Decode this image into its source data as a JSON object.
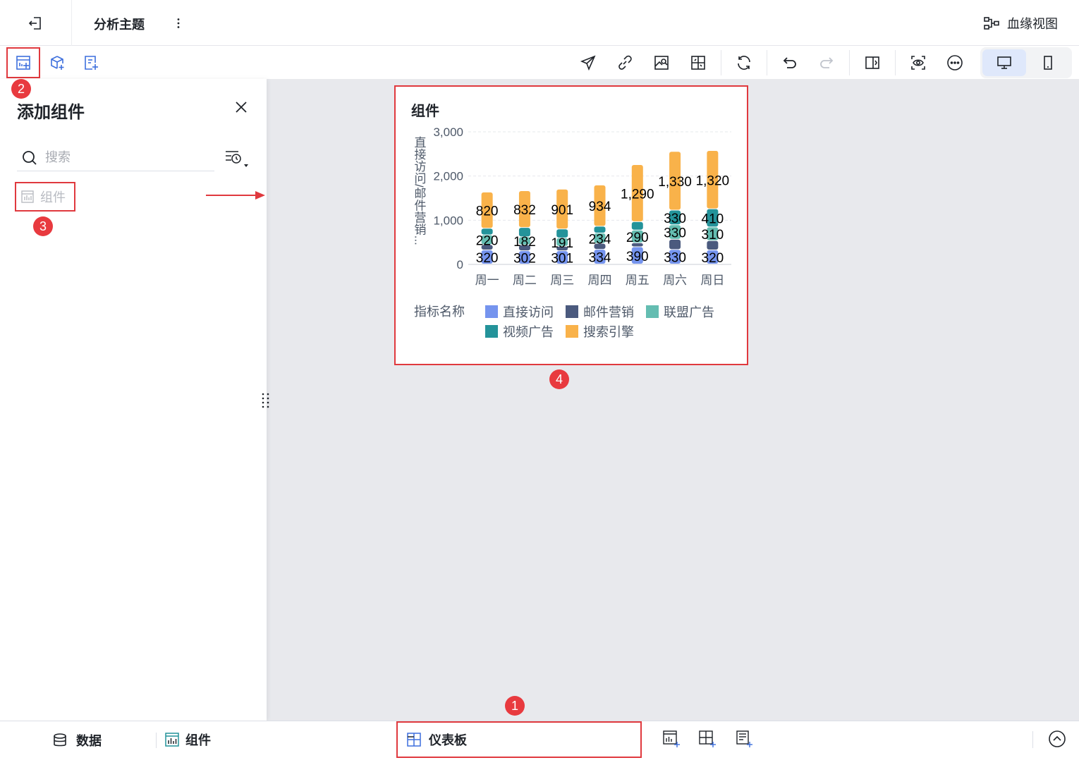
{
  "topbar": {
    "title": "分析主题",
    "lineage_label": "血缘视图"
  },
  "panel": {
    "title": "添加组件",
    "search_placeholder": "搜索",
    "component_item": "组件"
  },
  "badges": {
    "b1": "1",
    "b2": "2",
    "b3": "3",
    "b4": "4"
  },
  "card": {
    "title": "组件"
  },
  "bottombar": {
    "data_label": "数据",
    "component_label": "组件",
    "dashboard_label": "仪表板"
  },
  "colors": {
    "highlight_border": "#e0393e",
    "badge": "#e83a3f",
    "series": [
      "#7594ee",
      "#4b5a7e",
      "#64bdb1",
      "#24939a",
      "#f9b24a"
    ]
  },
  "chart_data": {
    "type": "bar",
    "stacked": true,
    "title": "",
    "ylabel": "直接访问/邮件营销...",
    "yticks": [
      "0",
      "1,000",
      "2,000",
      "3,000"
    ],
    "ylim": [
      0,
      3000
    ],
    "categories": [
      "周一",
      "周二",
      "周三",
      "周四",
      "周五",
      "周六",
      "周日"
    ],
    "legend_title": "指标名称",
    "series": [
      {
        "name": "直接访问",
        "values": [
          320,
          302,
          301,
          334,
          390,
          330,
          320
        ],
        "labels": [
          "320",
          "302",
          "301",
          "334",
          "390",
          "330",
          "320"
        ]
      },
      {
        "name": "邮件营销",
        "values": [
          120,
          132,
          101,
          134,
          90,
          230,
          210
        ],
        "labels": [
          "",
          "",
          "",
          "",
          "",
          "",
          ""
        ]
      },
      {
        "name": "联盟广告",
        "values": [
          220,
          182,
          191,
          234,
          290,
          330,
          310
        ],
        "labels": [
          "220",
          "182",
          "191",
          "234",
          "290",
          "330",
          "310"
        ]
      },
      {
        "name": "视频广告",
        "values": [
          150,
          212,
          201,
          154,
          190,
          330,
          410
        ],
        "labels": [
          "",
          "",
          "",
          "",
          "",
          "330",
          "410"
        ]
      },
      {
        "name": "搜索引擎",
        "values": [
          820,
          832,
          901,
          934,
          1290,
          1330,
          1320
        ],
        "labels": [
          "820",
          "832",
          "901",
          "934",
          "1,290",
          "1,330",
          "1,320"
        ]
      }
    ],
    "grid": true,
    "legend_position": "bottom"
  }
}
